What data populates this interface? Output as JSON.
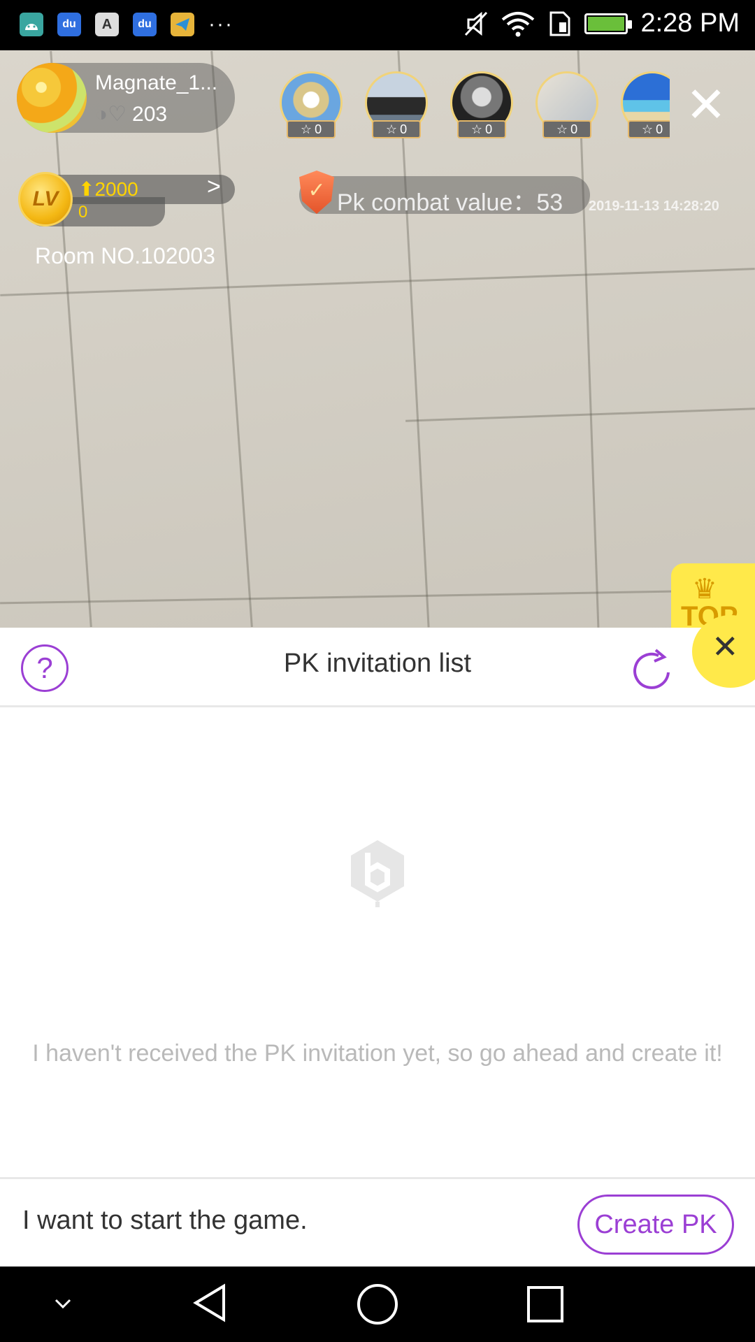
{
  "status_bar": {
    "time": "2:28 PM",
    "apps": [
      "android-icon",
      "baidu-icon",
      "font-a-icon",
      "baidu-icon",
      "telegram-icon"
    ],
    "app_letters": [
      "",
      "du",
      "A",
      "du",
      ""
    ],
    "more": "···"
  },
  "host": {
    "name": "Magnate_1...",
    "likes": "203"
  },
  "viewers": [
    {
      "count": "0"
    },
    {
      "count": "0"
    },
    {
      "count": "0"
    },
    {
      "count": "0"
    },
    {
      "count": "0"
    }
  ],
  "level": {
    "badge": "LV",
    "up_value": "2000",
    "current": "0"
  },
  "pk": {
    "label": "Pk combat value：53",
    "timestamp": "2019-11-13 14:28:20"
  },
  "room": "Room NO.102003",
  "top_badge": "TOP",
  "sheet": {
    "title": "PK invitation list",
    "help": "?",
    "empty_message": "I haven't received the PK invitation yet, so go ahead and create it!",
    "footer_text": "I want to start the game.",
    "create_button": "Create PK"
  },
  "colors": {
    "accent": "#9b3fd4",
    "yellow": "#ffe94a",
    "gold": "#ffd400"
  }
}
